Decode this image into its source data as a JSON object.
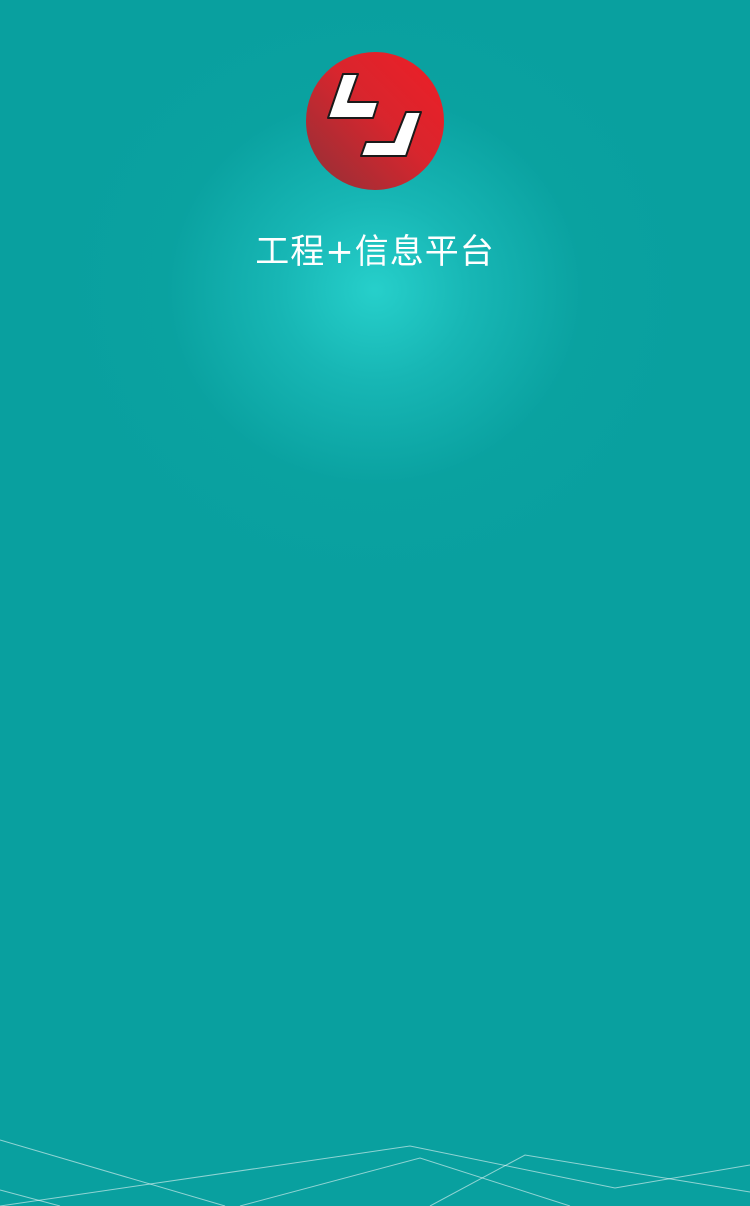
{
  "app": {
    "title": "工程+信息平台",
    "logo_icon": "company-logo-icon"
  },
  "colors": {
    "background": "#09a09f",
    "glow": "#28d2cd",
    "logo_red": "#e5232b",
    "logo_dark_red": "#9b2f37",
    "title_text": "#ffffff"
  }
}
